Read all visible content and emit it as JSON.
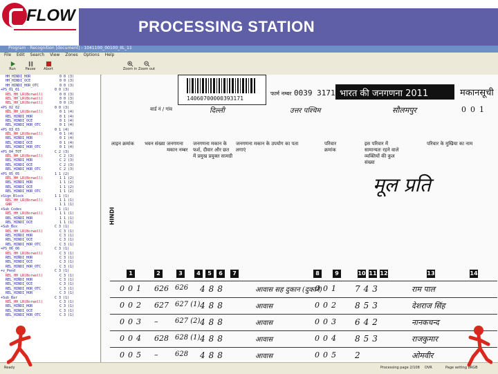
{
  "slide": {
    "logo_text": "FLOW",
    "title": "PROCESSING STATION"
  },
  "colors": {
    "title_band": "#5f5fa8",
    "logo_red": "#c8102e",
    "app_bg": "#ece9d8"
  },
  "app": {
    "window_title": "Program - Recognition [document] - 1041100_00100_IIL_11",
    "menus": [
      "File",
      "Edit",
      "Search",
      "View",
      "Zones",
      "Options",
      "Help"
    ],
    "toolbar": [
      {
        "label": "Run",
        "icon": "run-icon"
      },
      {
        "label": "Pause",
        "icon": "pause-icon"
      },
      {
        "label": "Abort",
        "icon": "abort-icon"
      },
      {
        "label": "Zoom in",
        "icon": "zoom-in-icon"
      },
      {
        "label": "Zoom out",
        "icon": "zoom-out-icon"
      }
    ],
    "tree_items": [
      {
        "name": "HH_HINDI_HOR",
        "val": "0 0 (3)",
        "color": "blue"
      },
      {
        "name": "HH_HINDI_OCE",
        "val": "0 0 (3)",
        "color": "blue"
      },
      {
        "name": "HH_HINDI_HOR_OTC",
        "val": "0 0 (3)",
        "color": "blue"
      },
      {
        "name": "+PS_01_01",
        "val": "0 0 (3)",
        "color": "blue"
      },
      {
        "name": "REL_HH_LR(Borwell)",
        "val": "0 0 (3)",
        "color": "red"
      },
      {
        "name": "REL_HH_LR(Borwell)",
        "val": "0 0 (3)",
        "color": "red"
      },
      {
        "name": "REL_HH_LR(Borwell)",
        "val": "0 0 (3)",
        "color": "red"
      },
      {
        "name": "+PS_02_02",
        "val": "0 0 (3)",
        "color": "blue"
      },
      {
        "name": "REL_HH_LR(Borwell)",
        "val": "0 1 (4)",
        "color": "red"
      },
      {
        "name": "REL_HINDI_HOR",
        "val": "0 1 (4)",
        "color": "blue"
      },
      {
        "name": "REL_HINDI_OCE",
        "val": "0 1 (4)",
        "color": "blue"
      },
      {
        "name": "REL_HINDI_HOR_OTC",
        "val": "0 1 (4)",
        "color": "blue"
      },
      {
        "name": "+PS_03_03",
        "val": "0 1 (4)",
        "color": "blue"
      },
      {
        "name": "REL_HH_LR(Borwell)",
        "val": "0 1 (4)",
        "color": "red"
      },
      {
        "name": "REL_HINDI_HOR",
        "val": "0 1 (4)",
        "color": "blue"
      },
      {
        "name": "REL_HINDI_OCE",
        "val": "0 1 (4)",
        "color": "blue"
      },
      {
        "name": "REL_HINDI_HOR_OTC",
        "val": "0 1 (4)",
        "color": "blue"
      },
      {
        "name": "+PS_04_TOT",
        "val": "C 2 (3)",
        "color": "blue"
      },
      {
        "name": "REL_HH_LR(Borwell)",
        "val": "C 2 (3)",
        "color": "red"
      },
      {
        "name": "REL_HINDI_HOR",
        "val": "C 2 (3)",
        "color": "blue"
      },
      {
        "name": "REL_HINDI_OCE",
        "val": "C 2 (3)",
        "color": "blue"
      },
      {
        "name": "REL_HINDI_HOR_OTC",
        "val": "C 2 (3)",
        "color": "blue"
      },
      {
        "name": "+PS_05_05",
        "val": "1 1 (2)",
        "color": "blue"
      },
      {
        "name": "REL_HH_LR(Borwell)",
        "val": "1 1 (2)",
        "color": "red"
      },
      {
        "name": "REL_HINDI_HOR",
        "val": "1 1 (2)",
        "color": "blue"
      },
      {
        "name": "REL_HINDI_OCE",
        "val": "1 1 (2)",
        "color": "blue"
      },
      {
        "name": "REL_HINDI_HOR_OTC",
        "val": "1 1 (2)",
        "color": "blue"
      },
      {
        "name": "+Sign_Block",
        "val": "1 1 (1)",
        "color": "blue"
      },
      {
        "name": "REL_HH_LR(Borwell)",
        "val": "1 1 (1)",
        "color": "red"
      },
      {
        "name": "GNR",
        "val": "1 1 (1)",
        "color": "red"
      },
      {
        "name": "+Sub_Codes",
        "val": "1 1 (1)",
        "color": "blue"
      },
      {
        "name": "REL_HH_LR(Borwell)",
        "val": "1 1 (1)",
        "color": "red"
      },
      {
        "name": "REL_HINDI_HOR",
        "val": "1 1 (1)",
        "color": "blue"
      },
      {
        "name": "REL_HINDI_OCE",
        "val": "1 1 (1)",
        "color": "blue"
      },
      {
        "name": "+Sub_Box",
        "val": "C 3 (1)",
        "color": "blue"
      },
      {
        "name": "REL_HH_LR(Borwell)",
        "val": "C 3 (1)",
        "color": "red"
      },
      {
        "name": "REL_HINDI_HOR",
        "val": "C 3 (1)",
        "color": "blue"
      },
      {
        "name": "REL_HINDI_OCE",
        "val": "C 3 (1)",
        "color": "blue"
      },
      {
        "name": "REL_HINDI_HOR_OTC",
        "val": "C 3 (1)",
        "color": "blue"
      },
      {
        "name": "+PS_06_06",
        "val": "C 3 (1)",
        "color": "blue"
      },
      {
        "name": "REL_HH_LR(Borwell)",
        "val": "C 3 (1)",
        "color": "red"
      },
      {
        "name": "REL_HINDI_HOR",
        "val": "C 3 (1)",
        "color": "blue"
      },
      {
        "name": "REL_HINDI_OCE",
        "val": "C 3 (1)",
        "color": "blue"
      },
      {
        "name": "REL_HINDI_HOR_OTC",
        "val": "C 3 (1)",
        "color": "blue"
      },
      {
        "name": "+v_Pend",
        "val": "C 3 (1)",
        "color": "blue"
      },
      {
        "name": "REL_HH_LR(Borwell)",
        "val": "C 3 (1)",
        "color": "red"
      },
      {
        "name": "REL_HINDI_HOR",
        "val": "C 3 (1)",
        "color": "blue"
      },
      {
        "name": "REL_HINDI_OCE",
        "val": "C 3 (1)",
        "color": "blue"
      },
      {
        "name": "REL_HINDI_HOR_OTC",
        "val": "C 3 (1)",
        "color": "blue"
      },
      {
        "name": "REL_HINDI_HOR",
        "val": "C 3 (1)",
        "color": "blue"
      },
      {
        "name": "+Sub_Bar",
        "val": "C 3 (1)",
        "color": "blue"
      },
      {
        "name": "REL_HH_LR(Borwell)",
        "val": "C 3 (1)",
        "color": "red"
      },
      {
        "name": "REL_HINDI_HOR",
        "val": "C 3 (1)",
        "color": "blue"
      },
      {
        "name": "REL_HINDI_OCE",
        "val": "C 3 (1)",
        "color": "blue"
      },
      {
        "name": "REL_HINDI_HOR_OTC",
        "val": "C 3 (1)",
        "color": "blue"
      }
    ],
    "status": {
      "left": "Ready",
      "page": "Processing page 2/108",
      "mode": "OVR",
      "pages": "Page setting 8RGB"
    }
  },
  "form": {
    "barcode_text": "14060700000393171",
    "form_label": "फार्म नम्बर",
    "form_number": "0039 3171",
    "census_title": "भारत की जनगणना 2011",
    "house_label": "मकानसूची",
    "village_label": "वार्ड नं / गांव",
    "village_hand": "दिल्ली",
    "section_hand": "उत्तर पश्चिम",
    "area_hand": "सौलमपुर",
    "area_num": "001",
    "col_header_1": "लाइन क्रमांक",
    "col_header_2": "भवन संख्या",
    "col_header_3": "जनगणना मकान नम्बर",
    "col_header_4": "जनगणना मकान के फर्श, दीवार और छत में प्रमुख प्रयुक्त सामग्री",
    "col_header_5": "जनगणना मकान के उपयोग का पता लगाएं",
    "col_header_6": "परिवार क्रमांक",
    "col_header_7": "इस परिवार में सामान्यतः रहने वाले व्यक्तियों की कुल संख्या",
    "col_header_8": "परिवार के मुखिया का नाम",
    "stamp_text": "मूल प्रति",
    "hindi_label": "HINDI",
    "column_numbers": [
      "1",
      "2",
      "3",
      "4",
      "5",
      "6",
      "7",
      "8",
      "9",
      "10",
      "11",
      "12",
      "13",
      "14"
    ],
    "rows": [
      {
        "line": "001",
        "bldg": "626",
        "house": "626",
        "mat": "488",
        "use": "आवास सह दुकान (दुकाने)",
        "fam": "001",
        "cnt": "743",
        "name": "राम पाल"
      },
      {
        "line": "002",
        "bldg": "627",
        "house": "627 (1)",
        "mat": "488",
        "use": "आवास",
        "fam": "002",
        "cnt": "853",
        "name": "देशराज सिंह"
      },
      {
        "line": "003",
        "bldg": "–",
        "house": "627 (2)",
        "mat": "488",
        "use": "आवास",
        "fam": "003",
        "cnt": "642",
        "name": "नानकचन्द"
      },
      {
        "line": "004",
        "bldg": "628",
        "house": "628 (1)",
        "mat": "488",
        "use": "आवास",
        "fam": "004",
        "cnt": "853",
        "name": "राजकुमार"
      },
      {
        "line": "005",
        "bldg": "–",
        "house": "628",
        "mat": "488",
        "use": "आवास",
        "fam": "005",
        "cnt": "2",
        "name": "ओमवीर"
      }
    ]
  }
}
